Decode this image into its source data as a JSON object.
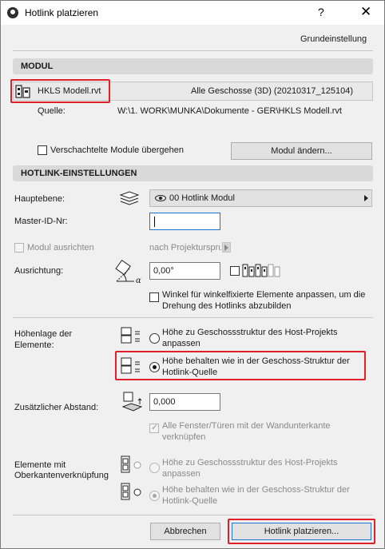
{
  "window": {
    "title": "Hotlink platzieren",
    "help_glyph": "?",
    "close_glyph": "✕"
  },
  "preset": "Grundeinstellung",
  "modul": {
    "header": "MODUL",
    "file_name": "HKLS Modell.rvt",
    "stories_info": "Alle Geschosse (3D) (20210317_125104)",
    "source_label": "Quelle:",
    "source_path": "W:\\1. WORK\\MUNKA\\Dokumente - GER\\HKLS Modell.rvt",
    "skip_nested_label": "Verschachtelte Module übergehen",
    "skip_nested_checked": false,
    "change_button": "Modul ändern..."
  },
  "hotlink": {
    "header": "HOTLINK-EINSTELLUNGEN",
    "main_story_label": "Hauptebene:",
    "main_story_value": "00 Hotlink Modul",
    "master_id_label": "Master-ID-Nr:",
    "master_id_value": "",
    "align_label": "Modul ausrichten",
    "align_value": "nach Projektursprung",
    "orientation_label": "Ausrichtung:",
    "orientation_value": "0,00°",
    "angle_fix_label": "Winkel für winkelfixierte Elemente anpassen, um die Drehung des Hotlinks abzubilden",
    "angle_fix_checked": false
  },
  "elevation": {
    "label": "Höhenlage der Elemente:",
    "option1": "Höhe zu Geschossstruktur des Host-Projekts anpassen",
    "option2": "Höhe behalten wie in der Geschoss-Struktur der Hotlink-Quelle",
    "selected": 2,
    "offset_label": "Zusätzlicher Abstand:",
    "offset_value": "0,000",
    "link_label": "Alle Fenster/Türen mit der Wandunterkante verknüpfen",
    "link_checked": true
  },
  "top_link": {
    "label": "Elemente mit Oberkantenverknüpfung",
    "option1": "Höhe zu Geschossstruktur des Host-Projekts anpassen",
    "option2": "Höhe behalten wie in der Geschoss-Struktur der Hotlink-Quelle",
    "selected": 2
  },
  "footer": {
    "cancel": "Abbrechen",
    "place": "Hotlink platzieren..."
  },
  "colors": {
    "highlight": "#e0202a",
    "focus": "#1d73d1",
    "section": "#d9d9d9"
  }
}
